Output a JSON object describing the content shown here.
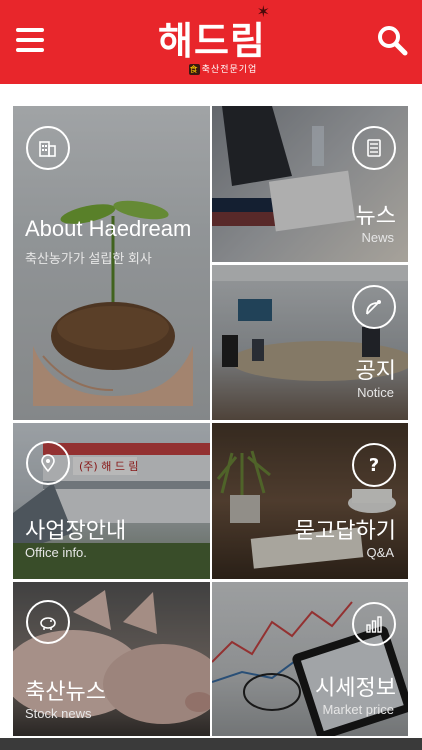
{
  "header": {
    "brand": "해드림",
    "tagline": "축산전문기업",
    "seal": "食",
    "background": "#e8262b"
  },
  "icons": {
    "menu": "hamburger-menu-icon",
    "search": "search-icon"
  },
  "tiles": [
    {
      "title": "About Haedream",
      "sub": "축산농가가 설립한 회사",
      "icon": "building-icon"
    },
    {
      "title": "뉴스",
      "sub": "News",
      "icon": "newspaper-icon"
    },
    {
      "title": "공지",
      "sub": "Notice",
      "icon": "satellite-dish-icon"
    },
    {
      "title": "사업장안내",
      "sub": "Office info.",
      "icon": "map-pin-icon"
    },
    {
      "title": "묻고답하기",
      "sub": "Q&A",
      "icon": "question-icon"
    },
    {
      "title": "축산뉴스",
      "sub": "Stock news",
      "icon": "piggy-bank-icon"
    },
    {
      "title": "시세정보",
      "sub": "Market price",
      "icon": "bar-chart-icon"
    }
  ]
}
